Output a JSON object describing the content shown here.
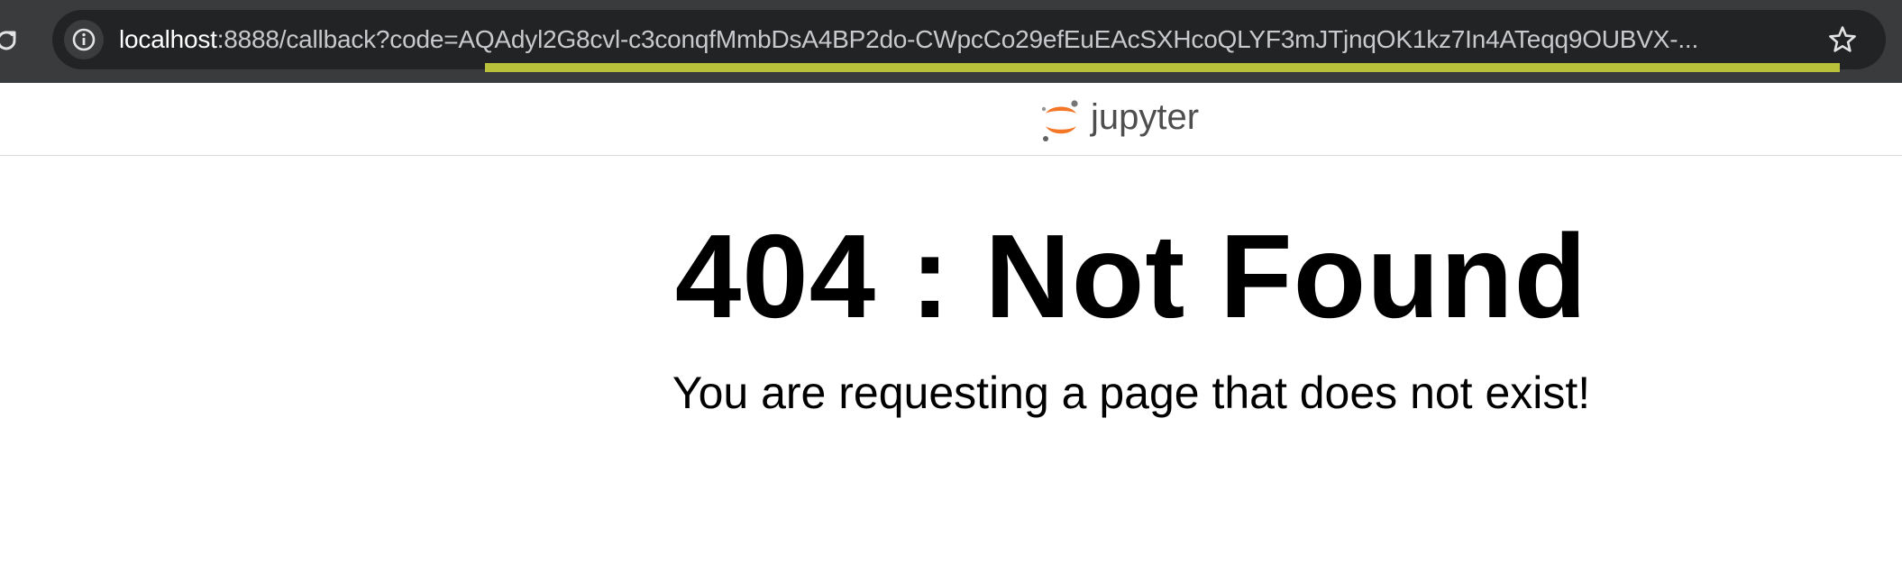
{
  "browser": {
    "url_host": "localhost",
    "url_rest": ":8888/callback?code=AQAdyl2G8cvl-c3conqfMmbDsA4BP2do-CWpcCo29efEuEAcSXHcoQLYF3mJTjnqOK1kz7In4ATeqq9OUBVX-...",
    "icons": {
      "reload": "reload-icon",
      "site_info": "info-icon",
      "bookmark": "star-icon"
    }
  },
  "header": {
    "logo_text": "jupyter",
    "logo_colors": {
      "orange": "#f37726",
      "gray": "#767677",
      "text": "#4e4e4e"
    }
  },
  "error": {
    "title": "404 : Not Found",
    "message": "You are requesting a page that does not exist!"
  }
}
